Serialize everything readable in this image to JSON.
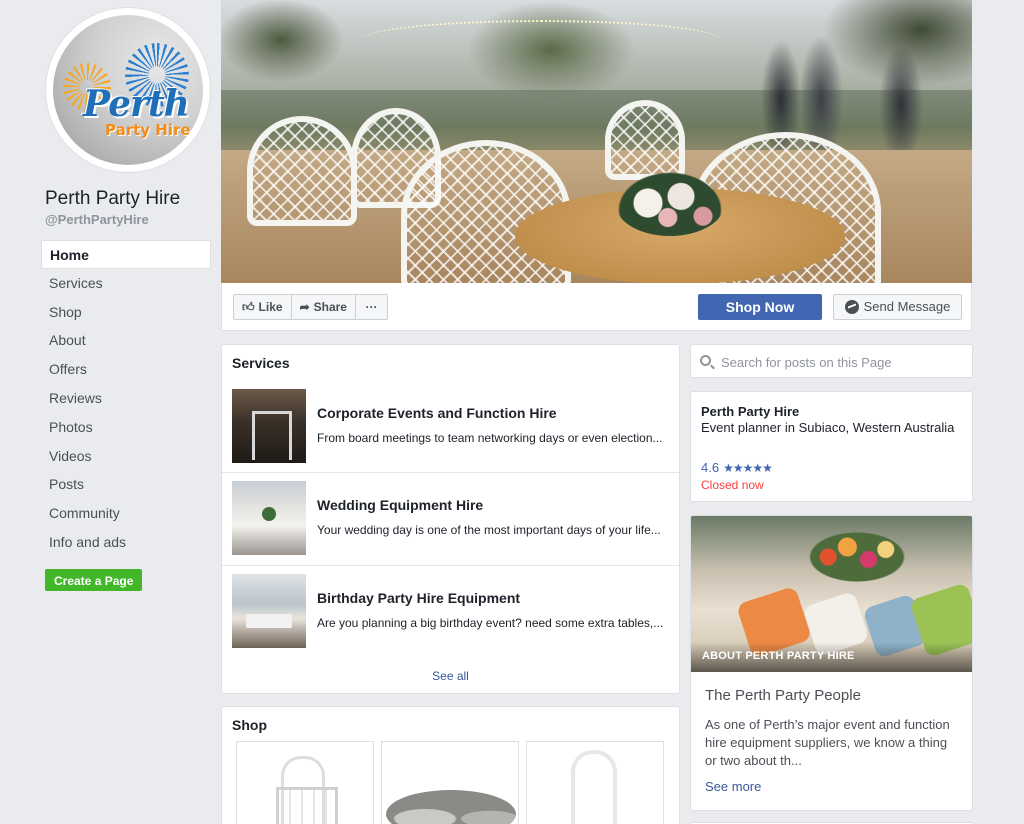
{
  "sidebar": {
    "page_name": "Perth Party Hire",
    "handle": "@PerthPartyHire",
    "logo_word1": "Perth",
    "logo_word2": "Party Hire",
    "nav": [
      {
        "label": "Home",
        "active": true
      },
      {
        "label": "Services"
      },
      {
        "label": "Shop"
      },
      {
        "label": "About"
      },
      {
        "label": "Offers"
      },
      {
        "label": "Reviews"
      },
      {
        "label": "Photos"
      },
      {
        "label": "Videos"
      },
      {
        "label": "Posts"
      },
      {
        "label": "Community"
      },
      {
        "label": "Info and ads"
      }
    ],
    "create_page": "Create a Page"
  },
  "actions": {
    "like": "Like",
    "share": "Share",
    "more": "···",
    "shop_now": "Shop Now",
    "send_message": "Send Message"
  },
  "services": {
    "title": "Services",
    "items": [
      {
        "title": "Corporate Events and Function Hire",
        "desc": "From board meetings to team networking days or even election..."
      },
      {
        "title": "Wedding Equipment Hire",
        "desc": "Your wedding day is one of the most important days of your life..."
      },
      {
        "title": "Birthday Party Hire Equipment",
        "desc": "Are you planning a big birthday event? need some extra tables,..."
      }
    ],
    "see_all": "See all"
  },
  "shop": {
    "title": "Shop"
  },
  "search": {
    "placeholder": "Search for posts on this Page"
  },
  "info": {
    "name": "Perth Party Hire",
    "category": "Event planner in Subiaco, Western Australia",
    "rating": "4.6",
    "stars": "★★★★★",
    "status": "Closed now"
  },
  "about": {
    "label": "ABOUT PERTH PARTY HIRE",
    "heading": "The Perth Party People",
    "text": "As one of Perth’s major event and function hire equipment suppliers, we know a thing or two about th...",
    "see_more": "See more"
  },
  "colors": {
    "primary": "#4267b2",
    "green": "#42b72a",
    "closed": "#fa3e3e",
    "background": "#e9ebee"
  }
}
